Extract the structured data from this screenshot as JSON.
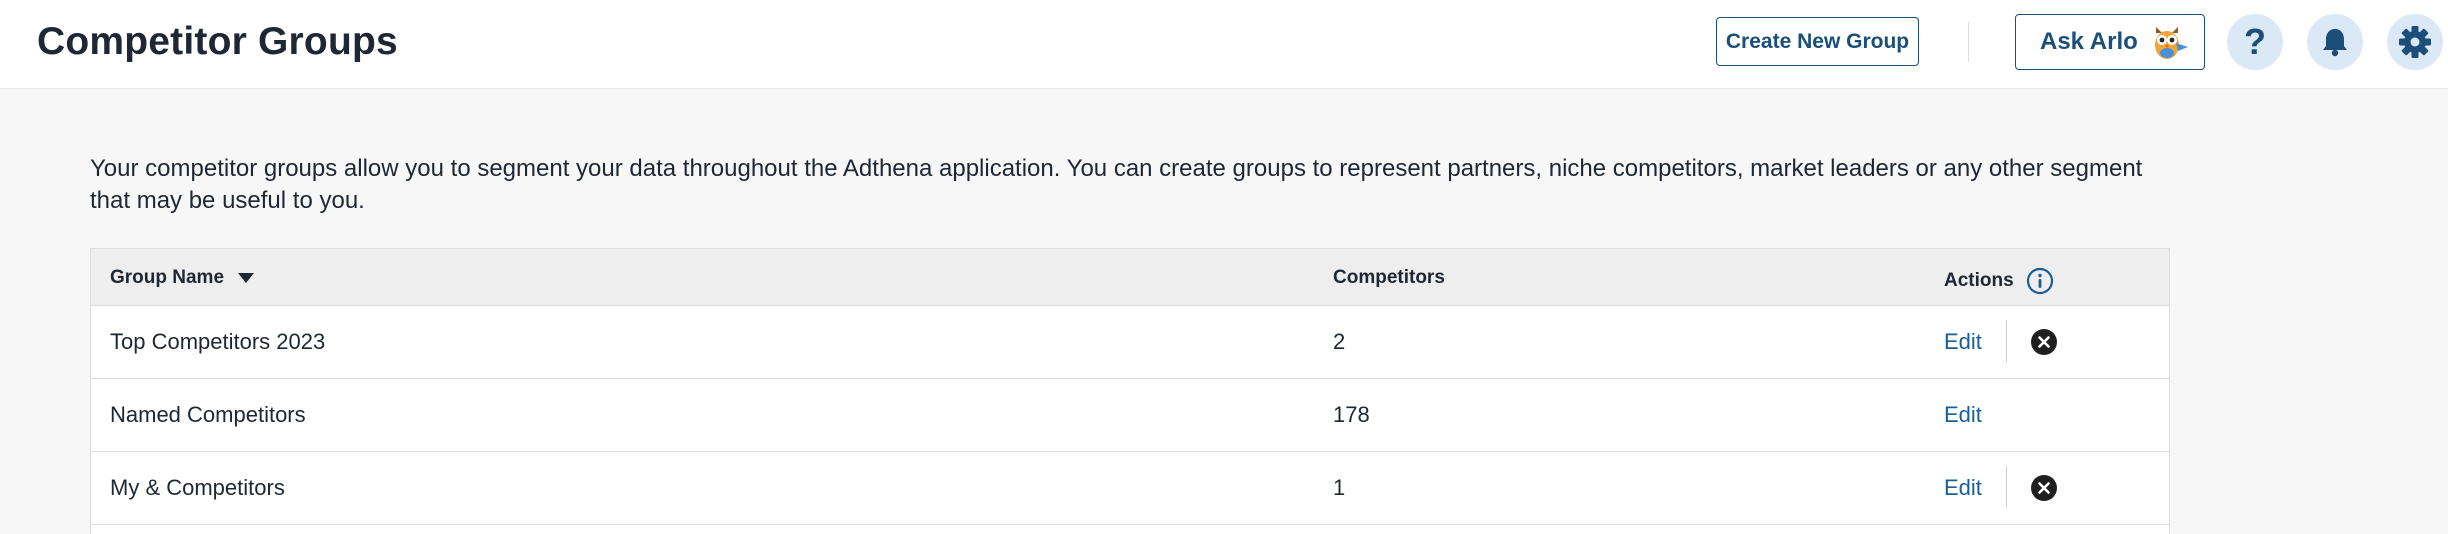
{
  "header": {
    "title": "Competitor Groups",
    "create_label": "Create New Group",
    "ask_label": "Ask Arlo",
    "help_glyph": "?"
  },
  "description": "Your competitor groups allow you to segment your data throughout the Adthena application. You can create groups to represent partners, niche competitors, market leaders or any other segment that may be useful to you.",
  "table": {
    "columns": {
      "name": "Group Name",
      "competitors": "Competitors",
      "actions": "Actions"
    },
    "rows": [
      {
        "name": "Top Competitors 2023",
        "competitors": "2",
        "edit": "Edit",
        "deletable": true
      },
      {
        "name": "Named Competitors",
        "competitors": "178",
        "edit": "Edit",
        "deletable": false
      },
      {
        "name": "My & Competitors",
        "competitors": "1",
        "edit": "Edit",
        "deletable": true
      }
    ]
  },
  "colors": {
    "accent": "#1b4f7a",
    "link": "#1b5e96",
    "icon_bg": "#dbe8f5"
  },
  "icons": [
    "owl-mascot-icon",
    "help-icon",
    "bell-icon",
    "gear-icon",
    "sort-down-icon",
    "info-icon",
    "delete-icon"
  ]
}
